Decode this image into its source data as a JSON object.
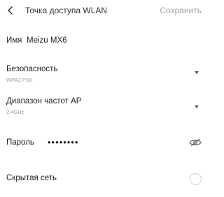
{
  "header": {
    "title": "Точка доступа WLAN",
    "save_label": "Сохранить"
  },
  "fields": {
    "name": {
      "label": "Имя",
      "value": "Meizu MX6"
    },
    "security": {
      "label": "Безопасность",
      "value": "WPA2 PSK"
    },
    "band": {
      "label": "Диапазон частот AP",
      "value": "2.4GHz"
    },
    "password": {
      "label": "Пароль",
      "value": "••••••••"
    },
    "hidden_network": {
      "label": "Скрытая сеть"
    }
  },
  "icons": {
    "back": "chevron-left-icon",
    "dropdown": "triangle-down-icon",
    "eye": "eye-icon"
  },
  "colors": {
    "text": "#222222",
    "muted": "#9a9a9a",
    "disabled": "#9e9e9e",
    "border": "#cfcfcf"
  }
}
